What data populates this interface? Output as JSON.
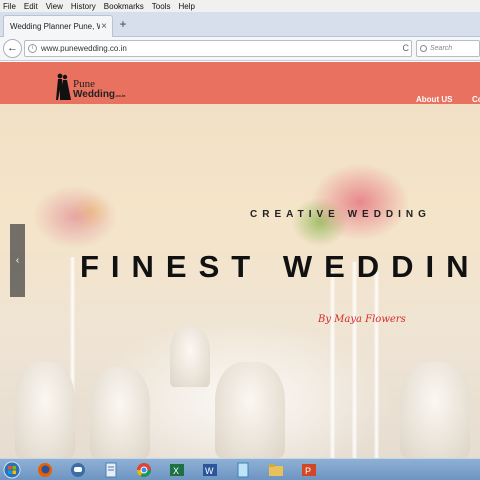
{
  "menubar": {
    "items": [
      {
        "label": "File",
        "key": "F"
      },
      {
        "label": "Edit",
        "key": "E"
      },
      {
        "label": "View",
        "key": "V"
      },
      {
        "label": "History",
        "key": "s"
      },
      {
        "label": "Bookmarks",
        "key": "B"
      },
      {
        "label": "Tools",
        "key": "T"
      },
      {
        "label": "Help",
        "key": "H"
      }
    ]
  },
  "tabs": {
    "active_title": "Wedding Planner Pune, Weddi...",
    "close_glyph": "×",
    "new_tab_glyph": "+"
  },
  "navbar": {
    "back_glyph": "←",
    "url": "www.punewedding.co.in",
    "reload_glyph": "C",
    "search_placeholder": "Search"
  },
  "site": {
    "logo": {
      "line1": "Pune",
      "line2": "Wedding",
      "domain": ".co.in"
    },
    "nav": {
      "about": "About US",
      "partial": "Co"
    },
    "hero": {
      "kicker": "CREATIVE WEDDING",
      "headline": "FINEST WEDDING D",
      "byline": "By Maya Flowers",
      "prev_glyph": "‹"
    }
  },
  "colors": {
    "header_bg": "#e86858",
    "byline": "#d42d2d",
    "taskbar": "#7ba2cc"
  },
  "taskbar": {
    "icons": [
      "start-orb-icon",
      "firefox-icon",
      "chat-icon",
      "document-icon",
      "chrome-icon",
      "excel-icon",
      "word-icon",
      "notepad-icon",
      "folder-icon",
      "powerpoint-icon"
    ]
  }
}
